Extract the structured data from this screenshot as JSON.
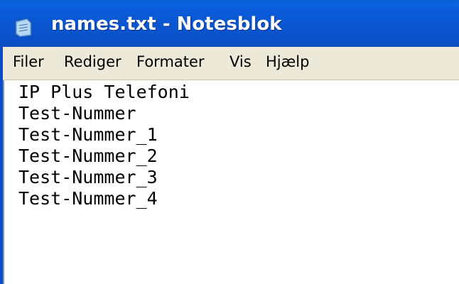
{
  "window": {
    "title": "names.txt - Notesblok",
    "icon": "notepad-icon"
  },
  "menu": {
    "items": [
      "Filer",
      "Rediger",
      "Formater",
      "Vis",
      "Hjælp"
    ]
  },
  "editor": {
    "lines": [
      "IP Plus Telefoni",
      "Test-Nummer",
      "Test-Nummer_1",
      "Test-Nummer_2",
      "Test-Nummer_3",
      "Test-Nummer_4"
    ]
  },
  "colors": {
    "titlebar": "#0a5ad6",
    "menubar": "#ece9d8",
    "editor_background": "#ffffff"
  }
}
